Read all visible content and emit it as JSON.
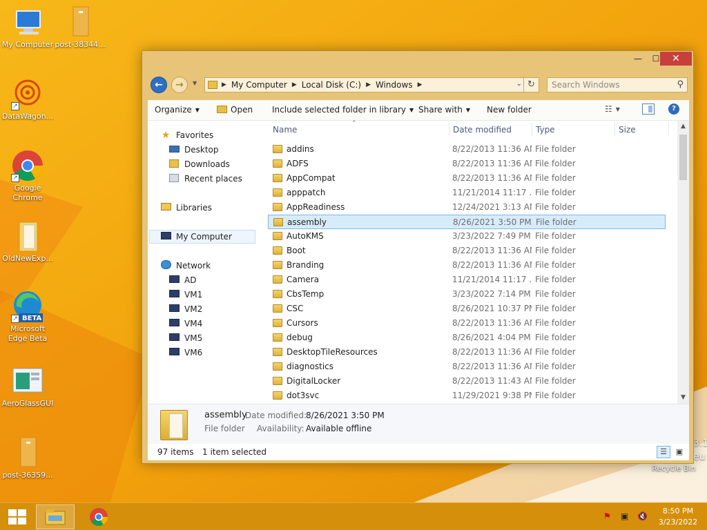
{
  "desktop": {
    "icons": [
      {
        "label": "My Computer",
        "icon": "computer-icon"
      },
      {
        "label": "post-38344...",
        "icon": "file-icon"
      },
      {
        "label": "DataWagon...",
        "icon": "datawagon-icon"
      },
      {
        "label": "Google Chrome",
        "icon": "chrome-icon"
      },
      {
        "label": "OldNewExp...",
        "icon": "folder-icon"
      },
      {
        "label": "Microsoft Edge Beta",
        "icon": "edge-beta-icon",
        "badge": "BETA"
      },
      {
        "label": "AeroGlassGUI",
        "icon": "aeroglass-icon"
      },
      {
        "label": "post-36359...",
        "icon": "file-icon"
      },
      {
        "label": "Recycle Bin",
        "icon": "recycle-bin-icon"
      }
    ],
    "watermark_partial": [
      "3.1",
      "eu"
    ]
  },
  "window": {
    "controls": {
      "minimize": "—",
      "maximize": "☐",
      "close": "✕"
    },
    "address": {
      "crumbs": [
        "My Computer",
        "Local Disk (C:)",
        "Windows"
      ]
    },
    "search": {
      "placeholder": "Search Windows"
    },
    "toolbar": {
      "organize": "Organize",
      "open": "Open",
      "include": "Include selected folder in library",
      "share": "Share with",
      "new_folder": "New folder"
    },
    "navpane": {
      "favorites": "Favorites",
      "desktop": "Desktop",
      "downloads": "Downloads",
      "recent": "Recent places",
      "libraries": "Libraries",
      "my_computer": "My Computer",
      "network": "Network",
      "network_items": [
        "AD",
        "VM1",
        "VM2",
        "VM4",
        "VM5",
        "VM6"
      ]
    },
    "columns": {
      "name": "Name",
      "date": "Date modified",
      "type": "Type",
      "size": "Size"
    },
    "files": [
      {
        "name": "addins",
        "date": "8/22/2013 11:36 AM",
        "type": "File folder"
      },
      {
        "name": "ADFS",
        "date": "8/22/2013 11:36 AM",
        "type": "File folder"
      },
      {
        "name": "AppCompat",
        "date": "8/22/2013 11:36 AM",
        "type": "File folder"
      },
      {
        "name": "apppatch",
        "date": "11/21/2014 11:17 ...",
        "type": "File folder"
      },
      {
        "name": "AppReadiness",
        "date": "12/24/2021 3:13 AM",
        "type": "File folder"
      },
      {
        "name": "assembly",
        "date": "8/26/2021 3:50 PM",
        "type": "File folder",
        "selected": true
      },
      {
        "name": "AutoKMS",
        "date": "3/23/2022 7:49 PM",
        "type": "File folder"
      },
      {
        "name": "Boot",
        "date": "8/22/2013 11:36 AM",
        "type": "File folder"
      },
      {
        "name": "Branding",
        "date": "8/22/2013 11:36 AM",
        "type": "File folder"
      },
      {
        "name": "Camera",
        "date": "11/21/2014 11:17 ...",
        "type": "File folder"
      },
      {
        "name": "CbsTemp",
        "date": "3/23/2022 7:14 PM",
        "type": "File folder"
      },
      {
        "name": "CSC",
        "date": "8/26/2021 10:37 PM",
        "type": "File folder"
      },
      {
        "name": "Cursors",
        "date": "8/22/2013 11:36 AM",
        "type": "File folder"
      },
      {
        "name": "debug",
        "date": "8/26/2021 4:04 PM",
        "type": "File folder"
      },
      {
        "name": "DesktopTileResources",
        "date": "8/22/2013 11:36 AM",
        "type": "File folder"
      },
      {
        "name": "diagnostics",
        "date": "8/22/2013 11:36 AM",
        "type": "File folder"
      },
      {
        "name": "DigitalLocker",
        "date": "8/22/2013 11:43 AM",
        "type": "File folder"
      },
      {
        "name": "dot3svc",
        "date": "11/29/2021 9:38 PM",
        "type": "File folder"
      }
    ],
    "details": {
      "name": "assembly",
      "type": "File folder",
      "date_label": "Date modified:",
      "date_value": "8/26/2021 3:50 PM",
      "avail_label": "Availability:",
      "avail_value": "Available offline"
    },
    "status": {
      "count": "97 items",
      "selected": "1 item selected"
    }
  },
  "taskbar": {
    "clock_time": "8:50 PM",
    "clock_date": "3/23/2022",
    "pinned": [
      "file-explorer-icon",
      "chrome-icon"
    ],
    "tray": [
      "action-center-flag-icon",
      "network-icon",
      "volume-muted-icon"
    ]
  },
  "colors": {
    "wallpaper": "#f2a10c",
    "taskbar": "#d58f0a",
    "accent": "#2d6fc6",
    "close": "#c7403b",
    "selection": "#d7ecfb"
  }
}
